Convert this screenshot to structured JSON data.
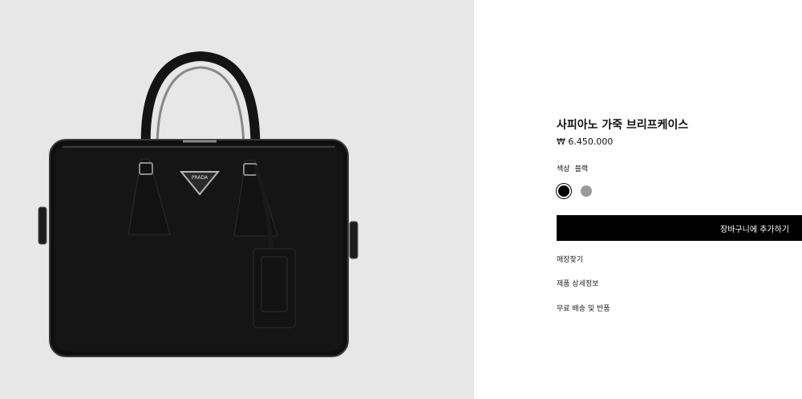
{
  "product": {
    "title": "사피아노 가죽 브리프케이스",
    "price": "₩ 6.450.000",
    "color_label": "색상",
    "color_value": "블랙",
    "swatches": [
      {
        "name": "black",
        "color": "#000000",
        "selected": true
      },
      {
        "name": "gray",
        "color": "#9a9a9a",
        "selected": false
      }
    ],
    "image_bg": "#e7e7e7",
    "logo_text": "PRADA"
  },
  "actions": {
    "add_to_cart": "장바구니에 추가하기"
  },
  "links": {
    "store_finder": "매장찾기",
    "product_details": "제품 상세정보",
    "shipping_returns": "무료 배송 및 반품"
  }
}
